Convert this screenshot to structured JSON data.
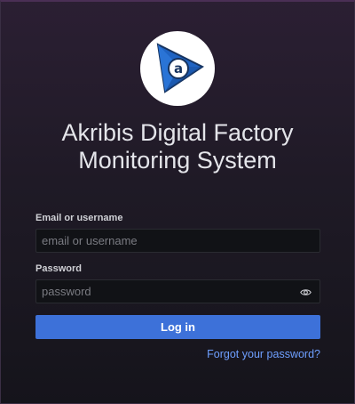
{
  "brand": {
    "logo_icon": "akribis-triangle-logo",
    "logo_letter": "a",
    "colors": {
      "logo_blue": "#1f63c2",
      "logo_dark": "#16335f"
    }
  },
  "title": {
    "line1": "Akribis Digital Factory",
    "line2": "Monitoring System"
  },
  "login_form": {
    "username_label": "Email or username",
    "username_placeholder": "email or username",
    "username_value": "",
    "password_label": "Password",
    "password_placeholder": "password",
    "password_value": "",
    "show_password_icon": "eye-icon",
    "login_label": "Log in",
    "forgot_label": "Forgot your password?"
  },
  "colors": {
    "accent": "#3d71d9",
    "link": "#6e9fff",
    "input_bg": "#111216"
  }
}
